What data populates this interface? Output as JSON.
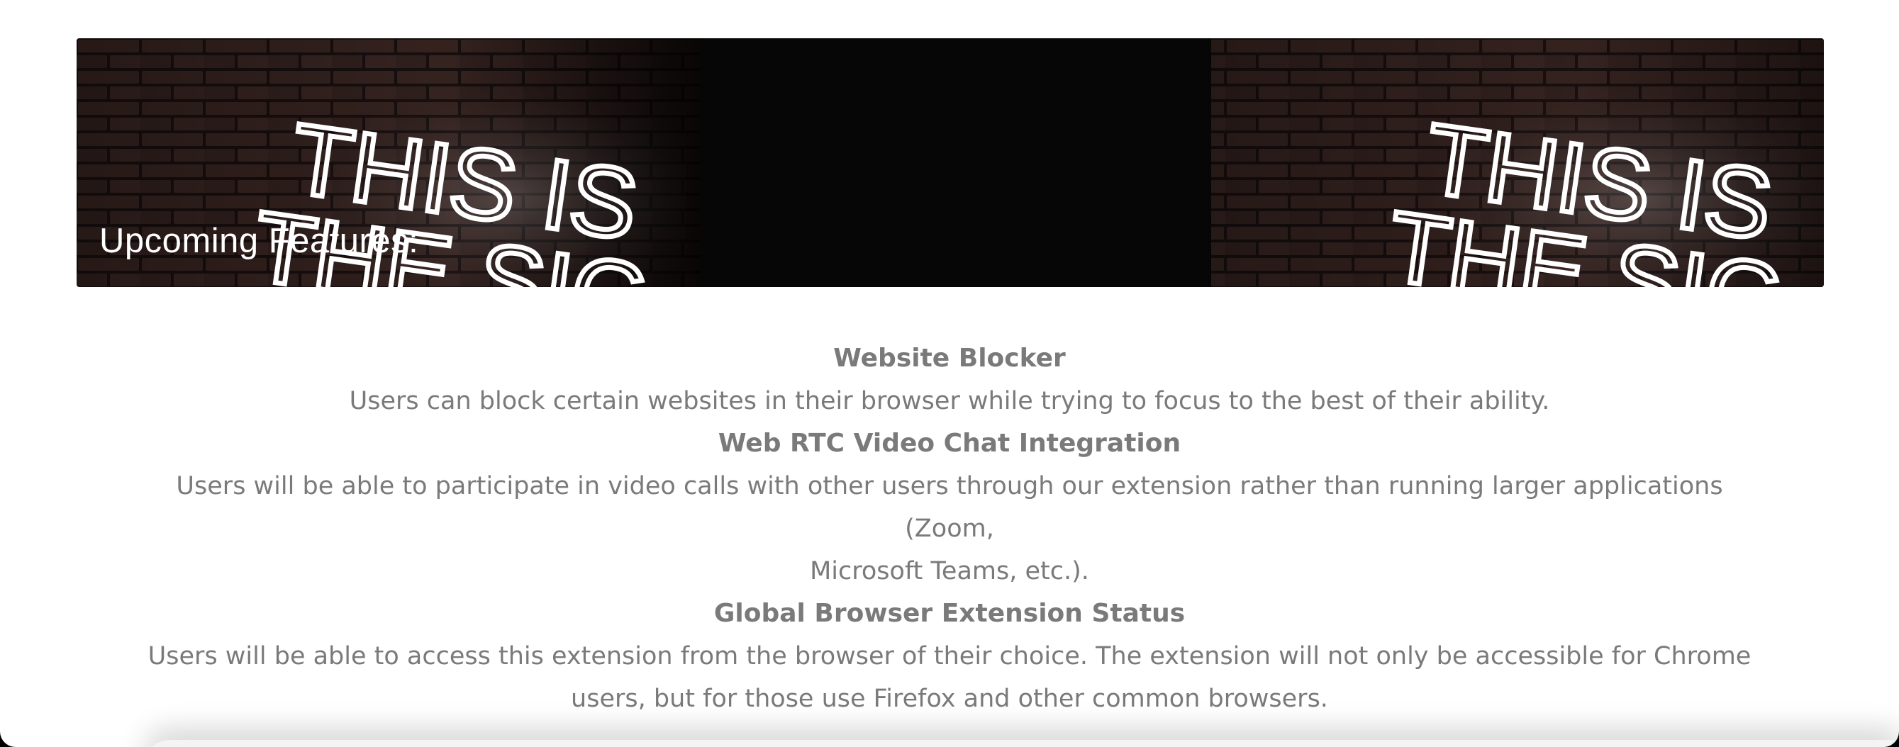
{
  "banner": {
    "title": "Upcoming Features:",
    "neon_text_line1": "THIS IS",
    "neon_text_line2": "THE SIG"
  },
  "features": [
    {
      "title": "Website Blocker",
      "description": "Users can block certain websites in their browser while trying to focus to the best of their ability."
    },
    {
      "title": "Web RTC Video Chat Integration",
      "description_line1": "Users will be able to participate in video calls with other users through our extension rather than running larger applications (Zoom,",
      "description_line2": "Microsoft Teams, etc.)."
    },
    {
      "title": "Global Browser Extension Status",
      "description_line1": "Users will be able to access this extension from the browser of their choice. The extension will not only be accessible for Chrome",
      "description_line2": "users, but for those use Firefox and other common browsers."
    }
  ],
  "colors": {
    "text": "#7a7a7a",
    "banner_bg": "#0a0a0a",
    "neon": "#ffffff"
  }
}
